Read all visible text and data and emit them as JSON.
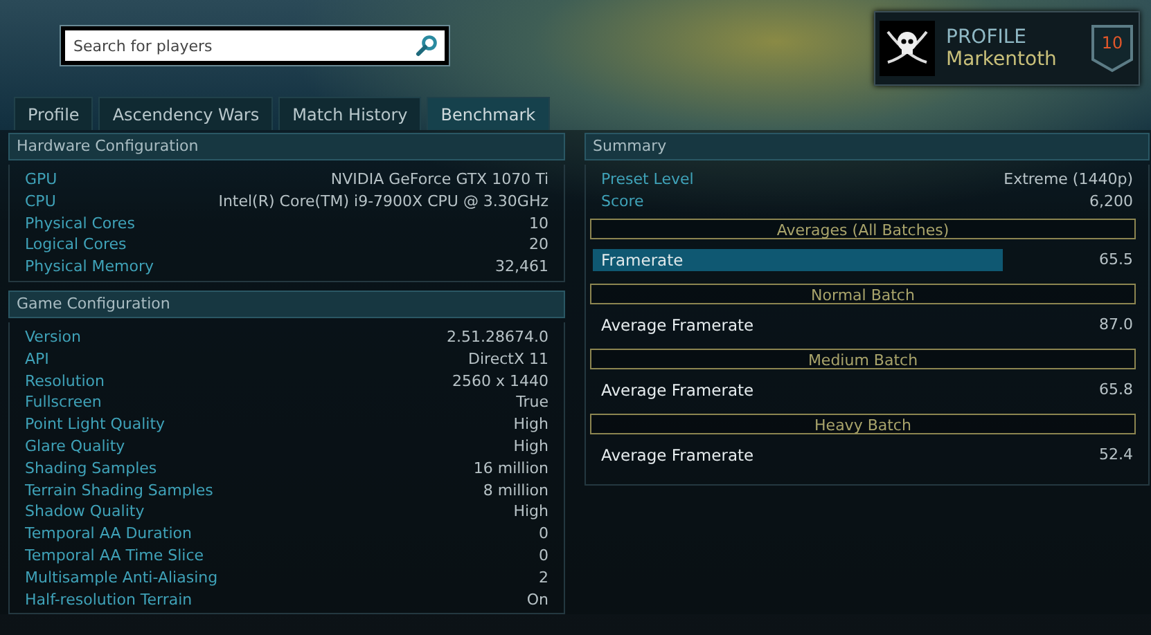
{
  "search": {
    "placeholder": "Search for players"
  },
  "profile": {
    "heading": "PROFILE",
    "name": "Markentoth",
    "rank": "10"
  },
  "tabs": [
    {
      "label": "Profile",
      "selected": false
    },
    {
      "label": "Ascendency Wars",
      "selected": false
    },
    {
      "label": "Match History",
      "selected": false
    },
    {
      "label": "Benchmark",
      "selected": true
    }
  ],
  "hardware": {
    "title": "Hardware Configuration",
    "rows": [
      {
        "label": "GPU",
        "value": "NVIDIA GeForce GTX 1070 Ti"
      },
      {
        "label": "CPU",
        "value": "Intel(R) Core(TM) i9-7900X CPU @ 3.30GHz"
      },
      {
        "label": "Physical Cores",
        "value": "10"
      },
      {
        "label": "Logical Cores",
        "value": "20"
      },
      {
        "label": "Physical Memory",
        "value": "32,461"
      }
    ]
  },
  "game": {
    "title": "Game Configuration",
    "rows": [
      {
        "label": "Version",
        "value": "2.51.28674.0"
      },
      {
        "label": "API",
        "value": "DirectX 11"
      },
      {
        "label": "Resolution",
        "value": "2560 x 1440"
      },
      {
        "label": "Fullscreen",
        "value": "True"
      },
      {
        "label": "Point Light Quality",
        "value": "High"
      },
      {
        "label": "Glare Quality",
        "value": "High"
      },
      {
        "label": "Shading Samples",
        "value": "16 million"
      },
      {
        "label": "Terrain Shading Samples",
        "value": "8 million"
      },
      {
        "label": "Shadow Quality",
        "value": "High"
      },
      {
        "label": "Temporal AA Duration",
        "value": "0"
      },
      {
        "label": "Temporal AA Time Slice",
        "value": "0"
      },
      {
        "label": "Multisample Anti-Aliasing",
        "value": "2"
      },
      {
        "label": "Half-resolution Terrain",
        "value": "On"
      }
    ]
  },
  "summary": {
    "title": "Summary",
    "rows": [
      {
        "label": "Preset Level",
        "value": "Extreme (1440p)"
      },
      {
        "label": "Score",
        "value": "6,200"
      }
    ],
    "sections": [
      {
        "heading": "Averages (All Batches)",
        "kind": "bar",
        "label": "Framerate",
        "value": "65.5",
        "level": 0.76
      },
      {
        "heading": "Normal Batch",
        "kind": "plain",
        "label": "Average Framerate",
        "value": "87.0"
      },
      {
        "heading": "Medium Batch",
        "kind": "plain",
        "label": "Average Framerate",
        "value": "65.8"
      },
      {
        "heading": "Heavy Batch",
        "kind": "plain",
        "label": "Average Framerate",
        "value": "52.4"
      }
    ]
  }
}
